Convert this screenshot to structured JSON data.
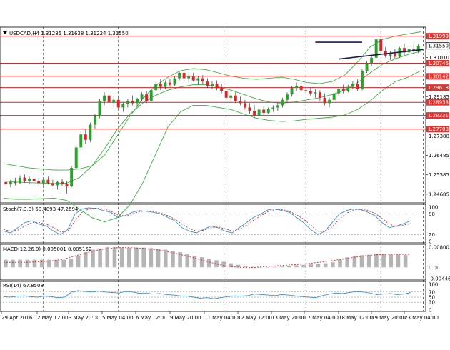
{
  "header": {
    "symbol_line": "USDCAD,H4  1.31285 1.31638 1.31224 1.31550"
  },
  "colors": {
    "bull": "#2ca02c",
    "bear": "#d62728",
    "bands": "#3cb043",
    "hline": "#d62728",
    "trendline": "#1a1a4e",
    "stoch_main": "#3d8fd6",
    "stoch_signal": "#d62728",
    "macd_hist": "#b4b4b4",
    "macd_signal": "#d62728",
    "rsi": "#3d8fd6",
    "grid": "#000000"
  },
  "chart_data": [
    {
      "type": "candlestick",
      "name_printed": "USDCAD,H4",
      "ylim": [
        1.2435,
        1.3235
      ],
      "price_ticks": [
        "1.31010",
        "1.29185",
        "1.27380",
        "1.26485",
        "1.25585",
        "1.24685"
      ],
      "horizontal_levels": [
        {
          "value": 1.31999,
          "label": "1.31999"
        },
        {
          "value": 1.30746,
          "label": "1.30746"
        },
        {
          "value": 1.30142,
          "label": "1.30142"
        },
        {
          "value": 1.29618,
          "label": "1.29618"
        },
        {
          "value": 1.28938,
          "label": "1.28938"
        },
        {
          "value": 1.28331,
          "label": "1.28331"
        },
        {
          "value": 1.277,
          "label": "1.27700"
        }
      ],
      "current_price": {
        "value": 1.3155,
        "label": "1.31550"
      },
      "candles": [
        [
          1.2525,
          1.254,
          1.2505,
          1.2515
        ],
        [
          1.2515,
          1.2535,
          1.25,
          1.2525
        ],
        [
          1.2525,
          1.2545,
          1.251,
          1.252
        ],
        [
          1.252,
          1.2555,
          1.2515,
          1.2545
        ],
        [
          1.2545,
          1.256,
          1.252,
          1.253
        ],
        [
          1.253,
          1.255,
          1.2515,
          1.254
        ],
        [
          1.254,
          1.2555,
          1.2525,
          1.253
        ],
        [
          1.253,
          1.2545,
          1.251,
          1.252
        ],
        [
          1.252,
          1.254,
          1.2505,
          1.2535
        ],
        [
          1.2535,
          1.255,
          1.2515,
          1.252
        ],
        [
          1.252,
          1.2535,
          1.2505,
          1.251
        ],
        [
          1.251,
          1.253,
          1.249,
          1.2525
        ],
        [
          1.2525,
          1.254,
          1.2505,
          1.2515
        ],
        [
          1.2515,
          1.253,
          1.247,
          1.2505
        ],
        [
          1.2505,
          1.26,
          1.25,
          1.259
        ],
        [
          1.259,
          1.27,
          1.258,
          1.2685
        ],
        [
          1.2685,
          1.276,
          1.267,
          1.2745
        ],
        [
          1.2745,
          1.277,
          1.27,
          1.272
        ],
        [
          1.272,
          1.28,
          1.271,
          1.279
        ],
        [
          1.279,
          1.284,
          1.277,
          1.283
        ],
        [
          1.283,
          1.291,
          1.282,
          1.29
        ],
        [
          1.29,
          1.294,
          1.288,
          1.2925
        ],
        [
          1.2925,
          1.2945,
          1.288,
          1.2895
        ],
        [
          1.2895,
          1.292,
          1.287,
          1.2905
        ],
        [
          1.2905,
          1.292,
          1.286,
          1.287
        ],
        [
          1.287,
          1.2895,
          1.285,
          1.2885
        ],
        [
          1.2885,
          1.291,
          1.287,
          1.29
        ],
        [
          1.29,
          1.2925,
          1.288,
          1.289
        ],
        [
          1.289,
          1.2915,
          1.2875,
          1.291
        ],
        [
          1.291,
          1.294,
          1.29,
          1.293
        ],
        [
          1.293,
          1.2945,
          1.289,
          1.29
        ],
        [
          1.29,
          1.296,
          1.2895,
          1.295
        ],
        [
          1.295,
          1.299,
          1.294,
          1.298
        ],
        [
          1.298,
          1.3,
          1.295,
          1.2965
        ],
        [
          1.2965,
          1.2995,
          1.2955,
          1.2985
        ],
        [
          1.2985,
          1.3005,
          1.2965,
          1.2975
        ],
        [
          1.2975,
          1.3015,
          1.297,
          1.3005
        ],
        [
          1.3005,
          1.304,
          1.2995,
          1.303
        ],
        [
          1.303,
          1.3045,
          1.2995,
          1.3005
        ],
        [
          1.3005,
          1.3025,
          1.2985,
          1.3015
        ],
        [
          1.3015,
          1.303,
          1.299,
          1.2995
        ],
        [
          1.2995,
          1.3015,
          1.2975,
          1.3005
        ],
        [
          1.3005,
          1.302,
          1.298,
          1.299
        ],
        [
          1.299,
          1.3005,
          1.296,
          1.297
        ],
        [
          1.297,
          1.299,
          1.2955,
          1.298
        ],
        [
          1.298,
          1.2995,
          1.295,
          1.296
        ],
        [
          1.296,
          1.298,
          1.2935,
          1.2945
        ],
        [
          1.2945,
          1.296,
          1.29,
          1.2915
        ],
        [
          1.2915,
          1.2935,
          1.2895,
          1.2925
        ],
        [
          1.2925,
          1.294,
          1.289,
          1.29
        ],
        [
          1.29,
          1.292,
          1.288,
          1.289
        ],
        [
          1.289,
          1.2905,
          1.286,
          1.287
        ],
        [
          1.287,
          1.289,
          1.284,
          1.2855
        ],
        [
          1.2855,
          1.288,
          1.282,
          1.2835
        ],
        [
          1.2835,
          1.287,
          1.283,
          1.286
        ],
        [
          1.286,
          1.2875,
          1.2835,
          1.2845
        ],
        [
          1.2845,
          1.287,
          1.284,
          1.2865
        ],
        [
          1.2865,
          1.288,
          1.285,
          1.287
        ],
        [
          1.287,
          1.289,
          1.2855,
          1.288
        ],
        [
          1.288,
          1.2915,
          1.287,
          1.2905
        ],
        [
          1.2905,
          1.294,
          1.2895,
          1.293
        ],
        [
          1.293,
          1.297,
          1.292,
          1.296
        ],
        [
          1.296,
          1.2985,
          1.2945,
          1.297
        ],
        [
          1.297,
          1.2985,
          1.294,
          1.295
        ],
        [
          1.295,
          1.297,
          1.293,
          1.2945
        ],
        [
          1.2945,
          1.296,
          1.2925,
          1.2935
        ],
        [
          1.2935,
          1.2955,
          1.2915,
          1.294
        ],
        [
          1.294,
          1.295,
          1.29,
          1.2915
        ],
        [
          1.2915,
          1.2935,
          1.288,
          1.289
        ],
        [
          1.289,
          1.2915,
          1.287,
          1.2905
        ],
        [
          1.2905,
          1.294,
          1.29,
          1.2935
        ],
        [
          1.2935,
          1.2965,
          1.2925,
          1.2955
        ],
        [
          1.2955,
          1.2975,
          1.2935,
          1.2945
        ],
        [
          1.2945,
          1.2975,
          1.294,
          1.2965
        ],
        [
          1.2965,
          1.299,
          1.2955,
          1.298
        ],
        [
          1.298,
          1.3,
          1.2945,
          1.2955
        ],
        [
          1.2955,
          1.305,
          1.295,
          1.304
        ],
        [
          1.304,
          1.3085,
          1.303,
          1.3075
        ],
        [
          1.3075,
          1.311,
          1.306,
          1.31
        ],
        [
          1.31,
          1.3195,
          1.3095,
          1.3185
        ],
        [
          1.3185,
          1.32,
          1.312,
          1.313
        ],
        [
          1.313,
          1.315,
          1.31,
          1.311
        ],
        [
          1.311,
          1.313,
          1.309,
          1.312
        ],
        [
          1.312,
          1.314,
          1.3095,
          1.3105
        ],
        [
          1.3105,
          1.315,
          1.31,
          1.3145
        ],
        [
          1.3145,
          1.3165,
          1.311,
          1.3125
        ],
        [
          1.3125,
          1.3155,
          1.3115,
          1.314
        ],
        [
          1.314,
          1.316,
          1.312,
          1.313
        ],
        [
          1.313,
          1.3164,
          1.3122,
          1.3155
        ]
      ],
      "bands": {
        "upper": [
          1.261,
          1.26,
          1.259,
          1.2585,
          1.258,
          1.258,
          1.2585,
          1.26,
          1.265,
          1.274,
          1.283,
          1.291,
          1.297,
          1.301,
          1.304,
          1.305,
          1.3045,
          1.303,
          1.3015,
          1.3005,
          1.3,
          1.3005,
          1.301,
          1.3,
          1.2985,
          1.298,
          1.299,
          1.302,
          1.308,
          1.315,
          1.3185,
          1.32,
          1.321,
          1.322
        ],
        "middle": [
          1.253,
          1.2525,
          1.2522,
          1.252,
          1.2518,
          1.252,
          1.2545,
          1.26,
          1.268,
          1.277,
          1.284,
          1.289,
          1.2925,
          1.295,
          1.2965,
          1.2975,
          1.2975,
          1.2965,
          1.295,
          1.293,
          1.291,
          1.2895,
          1.289,
          1.2895,
          1.2905,
          1.2915,
          1.293,
          1.295,
          1.2985,
          1.303,
          1.307,
          1.3095,
          1.3115,
          1.313
        ],
        "lower": [
          1.245,
          1.2445,
          1.2445,
          1.2448,
          1.245,
          1.244,
          1.24,
          1.236,
          1.234,
          1.236,
          1.242,
          1.252,
          1.265,
          1.278,
          1.285,
          1.288,
          1.288,
          1.287,
          1.286,
          1.284,
          1.282,
          1.281,
          1.2805,
          1.2808,
          1.2815,
          1.282,
          1.2825,
          1.2835,
          1.286,
          1.29,
          1.295,
          1.299,
          1.301,
          1.304
        ]
      },
      "trendlines": [
        {
          "x": [
            66,
            76
          ],
          "y": [
            1.3172,
            1.3172
          ]
        },
        {
          "x": [
            71,
            89
          ],
          "y": [
            1.3094,
            1.3138
          ]
        }
      ]
    },
    {
      "type": "line",
      "indicator_label": "Stoch(7,3,3) 60.4093 47.2694",
      "ylim": [
        0,
        100
      ],
      "ticks": [
        "100",
        "80",
        "20",
        "0"
      ],
      "levels": [
        80,
        20
      ],
      "main": [
        30,
        25,
        40,
        55,
        60,
        50,
        45,
        30,
        20,
        35,
        80,
        95,
        98,
        96,
        90,
        85,
        70,
        75,
        85,
        90,
        88,
        85,
        80,
        70,
        60,
        40,
        30,
        25,
        35,
        45,
        40,
        30,
        25,
        40,
        55,
        70,
        80,
        92,
        95,
        90,
        85,
        70,
        55,
        35,
        20,
        30,
        55,
        80,
        90,
        95,
        93,
        85,
        75,
        55,
        40,
        45,
        52,
        60
      ],
      "signal": [
        35,
        30,
        33,
        45,
        55,
        55,
        50,
        40,
        28,
        30,
        60,
        85,
        95,
        97,
        95,
        88,
        78,
        74,
        80,
        87,
        89,
        87,
        83,
        75,
        65,
        50,
        38,
        30,
        32,
        40,
        42,
        37,
        30,
        35,
        48,
        62,
        75,
        87,
        93,
        93,
        88,
        78,
        65,
        48,
        30,
        28,
        42,
        65,
        82,
        92,
        94,
        90,
        82,
        67,
        50,
        44,
        48,
        52
      ]
    },
    {
      "type": "bar",
      "indicator_label": "MACD(12,26,9) 0.005001 0.005152",
      "ylim": [
        -0.00446,
        0.008002
      ],
      "ticks": [
        "0.008002",
        "0.00",
        "-0.004466"
      ],
      "histogram": [
        0.003,
        0.003,
        0.003,
        0.003,
        0.003,
        0.003,
        0.003,
        0.003,
        0.003,
        0.0035,
        0.0045,
        0.006,
        0.007,
        0.0075,
        0.008,
        0.008,
        0.0078,
        0.0078,
        0.0078,
        0.0078,
        0.0076,
        0.0074,
        0.007,
        0.0065,
        0.006,
        0.0052,
        0.0046,
        0.004,
        0.0034,
        0.0028,
        0.0022,
        0.0016,
        0.001,
        0.0005,
        0.0002,
        0.0,
        0.0,
        0.0001,
        0.0003,
        0.0005,
        0.0008,
        0.001,
        0.0012,
        0.0014,
        0.0016,
        0.002,
        0.003,
        0.004,
        0.0045,
        0.0048,
        0.005,
        0.0052,
        0.0053,
        0.0052,
        0.0051,
        0.005
      ],
      "signal": [
        0.002,
        0.002,
        0.002,
        0.002,
        0.0021,
        0.0022,
        0.0024,
        0.0027,
        0.0032,
        0.004,
        0.0048,
        0.0056,
        0.0064,
        0.007,
        0.0074,
        0.0077,
        0.0078,
        0.0078,
        0.0077,
        0.0075,
        0.0072,
        0.0068,
        0.0063,
        0.0057,
        0.005,
        0.0043,
        0.0035,
        0.0027,
        0.0019,
        0.0012,
        0.0006,
        0.0002,
        0.0,
        -0.0001,
        0.0,
        0.0002,
        0.0004,
        0.0006,
        0.0008,
        0.001,
        0.0012,
        0.0015,
        0.0018,
        0.0021,
        0.0025,
        0.0029,
        0.0033,
        0.0038,
        0.0042,
        0.0046,
        0.0049,
        0.0051,
        0.0052,
        0.0052,
        0.0052,
        0.0052
      ]
    },
    {
      "type": "line",
      "indicator_label": "RSI(14) 67.8508",
      "ylim": [
        0,
        100
      ],
      "ticks": [
        "100",
        "70",
        "50",
        "30",
        "0"
      ],
      "levels": [
        70,
        50,
        30
      ],
      "values": [
        52,
        50,
        54,
        55,
        52,
        50,
        54,
        52,
        48,
        50,
        70,
        75,
        72,
        70,
        74,
        70,
        68,
        66,
        72,
        70,
        65,
        66,
        62,
        64,
        60,
        58,
        55,
        54,
        50,
        46,
        48,
        44,
        48,
        52,
        55,
        54,
        56,
        62,
        60,
        58,
        56,
        60,
        58,
        55,
        52,
        50,
        48,
        56,
        62,
        66,
        64,
        68,
        72,
        70,
        66,
        60,
        62,
        64,
        60,
        62,
        68
      ]
    }
  ],
  "x_axis": {
    "labels": [
      "29 Apr 2016",
      "2 May 12:00",
      "3 May 20:00",
      "5 May 04:00",
      "6 May 12:00",
      "9 May 20:00",
      "11 May 04:00",
      "12 May 12:00",
      "13 May 20:00",
      "17 May 04:00",
      "18 May 12:00",
      "19 May 20:00",
      "23 May 04:00"
    ]
  }
}
